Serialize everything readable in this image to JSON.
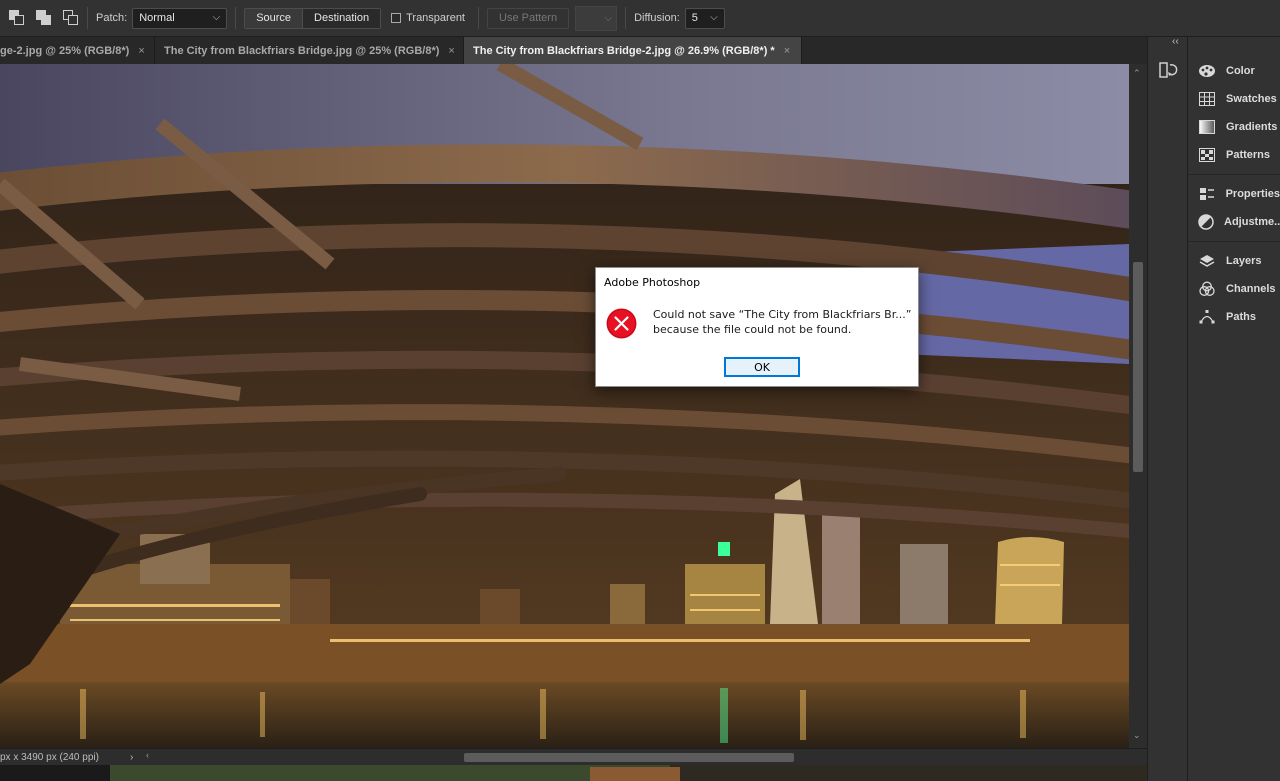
{
  "options_bar": {
    "patch_label": "Patch:",
    "patch_value": "Normal",
    "source_label": "Source",
    "destination_label": "Destination",
    "transparent_label": "Transparent",
    "use_pattern_label": "Use Pattern",
    "diffusion_label": "Diffusion:",
    "diffusion_value": "5"
  },
  "tabs": [
    {
      "label": "ge-2.jpg @ 25% (RGB/8*)",
      "close": "×"
    },
    {
      "label": "The City from Blackfriars Bridge.jpg @ 25% (RGB/8*)",
      "close": "×"
    },
    {
      "label": "The City from Blackfriars Bridge-2.jpg @ 26.9% (RGB/8*) *",
      "close": "×"
    }
  ],
  "status_bar": {
    "doc_info": "px x 3490 px (240 ppi)",
    "arrow": "›"
  },
  "panels": {
    "collapse": "‹‹",
    "groups": [
      [
        {
          "label": "Color",
          "icon": "palette-icon"
        },
        {
          "label": "Swatches",
          "icon": "grid-icon"
        },
        {
          "label": "Gradients",
          "icon": "gradient-icon"
        },
        {
          "label": "Patterns",
          "icon": "patterns-icon"
        }
      ],
      [
        {
          "label": "Properties",
          "icon": "properties-icon"
        },
        {
          "label": "Adjustme...",
          "icon": "adjustments-icon"
        }
      ],
      [
        {
          "label": "Layers",
          "icon": "layers-icon"
        },
        {
          "label": "Channels",
          "icon": "channels-icon"
        },
        {
          "label": "Paths",
          "icon": "paths-icon"
        }
      ]
    ]
  },
  "dialog": {
    "title": "Adobe Photoshop",
    "message_line1": "Could not save “The City from Blackfriars Br...”",
    "message_line2": "because the file could not be found.",
    "ok_label": "OK"
  },
  "colors": {
    "error_red": "#e81123",
    "ok_border": "#0078d7",
    "panel_bg": "#323232"
  }
}
